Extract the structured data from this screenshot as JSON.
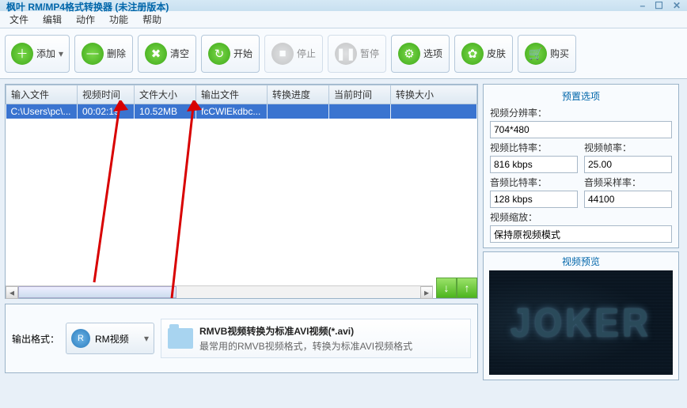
{
  "window": {
    "title": "枫叶 RM/MP4格式转换器   (未注册版本)"
  },
  "menu": [
    "文件",
    "编辑",
    "动作",
    "功能",
    "帮助"
  ],
  "toolbar": {
    "add": "添加",
    "del": "删除",
    "clear": "清空",
    "start": "开始",
    "stop": "停止",
    "pause": "暂停",
    "options": "选项",
    "skin": "皮肤",
    "buy": "购买"
  },
  "grid": {
    "headers": [
      "输入文件",
      "视频时间",
      "文件大小",
      "输出文件",
      "转换进度",
      "当前时间",
      "转换大小"
    ],
    "rows": [
      {
        "in": "C:\\Users\\pc\\...",
        "dur": "00:02:19",
        "size": "10.52MB",
        "out": "fcCWlEkdbc...",
        "prog": "",
        "cur": "",
        "conv": ""
      }
    ]
  },
  "outfmt": {
    "label": "输出格式：",
    "btn": "RM视频",
    "descTitle": "RMVB视频转换为标准AVI视频(*.avi)",
    "descSub": "最常用的RMVB视频格式，转换为标准AVI视频格式"
  },
  "presets": {
    "title": "预置选项",
    "res_l": "视频分辨率：",
    "res_v": "704*480",
    "vbr_l": "视频比特率：",
    "vbr_v": "816 kbps",
    "fps_l": "视频帧率：",
    "fps_v": "25.00",
    "abr_l": "音频比特率：",
    "abr_v": "128 kbps",
    "asr_l": "音频采样率：",
    "asr_v": "44100",
    "zoom_l": "视频缩放：",
    "zoom_v": "保持原视频模式"
  },
  "preview": {
    "title": "视频预览",
    "text": "JOKER"
  }
}
